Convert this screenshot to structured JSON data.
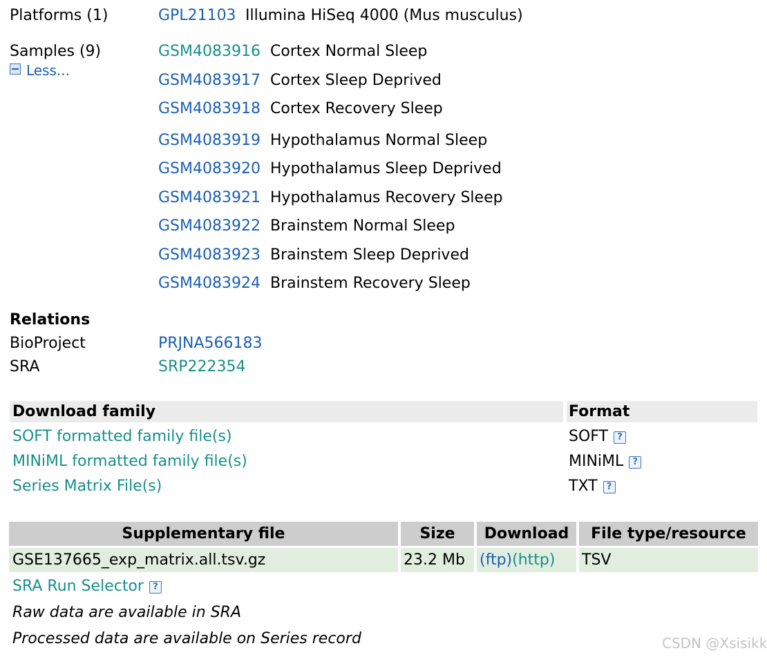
{
  "platforms": {
    "label": "Platforms (1)",
    "id": "GPL21103",
    "desc": "Illumina HiSeq 4000 (Mus musculus)"
  },
  "samples": {
    "label": "Samples (9)",
    "less": "Less...",
    "items": [
      {
        "id": "GSM4083916",
        "desc": "Cortex Normal Sleep"
      },
      {
        "id": "GSM4083917",
        "desc": "Cortex Sleep Deprived"
      },
      {
        "id": "GSM4083918",
        "desc": "Cortex Recovery Sleep"
      },
      {
        "id": "GSM4083919",
        "desc": "Hypothalamus Normal Sleep"
      },
      {
        "id": "GSM4083920",
        "desc": "Hypothalamus Sleep Deprived"
      },
      {
        "id": "GSM4083921",
        "desc": "Hypothalamus Recovery Sleep"
      },
      {
        "id": "GSM4083922",
        "desc": "Brainstem Normal Sleep"
      },
      {
        "id": "GSM4083923",
        "desc": "Brainstem Sleep Deprived"
      },
      {
        "id": "GSM4083924",
        "desc": "Brainstem Recovery Sleep"
      }
    ]
  },
  "relations": {
    "heading": "Relations",
    "bioproject_label": "BioProject",
    "bioproject_value": "PRJNA566183",
    "sra_label": "SRA",
    "sra_value": "SRP222354"
  },
  "download_family": {
    "col1": "Download family",
    "col2": "Format",
    "rows": [
      {
        "label": "SOFT formatted family file(s)",
        "format": "SOFT"
      },
      {
        "label": "MINiML formatted family file(s)",
        "format": "MINiML"
      },
      {
        "label": "Series Matrix File(s)",
        "format": "TXT"
      }
    ],
    "help_glyph": "?"
  },
  "supplementary": {
    "headers": [
      "Supplementary file",
      "Size",
      "Download",
      "File type/resource"
    ],
    "row": {
      "file": "GSE137665_exp_matrix.all.tsv.gz",
      "size": "23.2 Mb",
      "ftp": "(ftp)",
      "http": "(http)",
      "type": "TSV"
    }
  },
  "sra_run_selector": "SRA Run Selector",
  "notes": {
    "raw": "Raw data are available in SRA",
    "processed": "Processed data are available on Series record"
  },
  "watermark": "CSDN @Xsisikk",
  "colors": {
    "link_blue": "#1a5fb4",
    "link_teal": "#168f8a",
    "header_grey": "#ebebeb",
    "sup_header_grey": "#cdcdcd",
    "sup_row_green": "#e1eedf"
  }
}
